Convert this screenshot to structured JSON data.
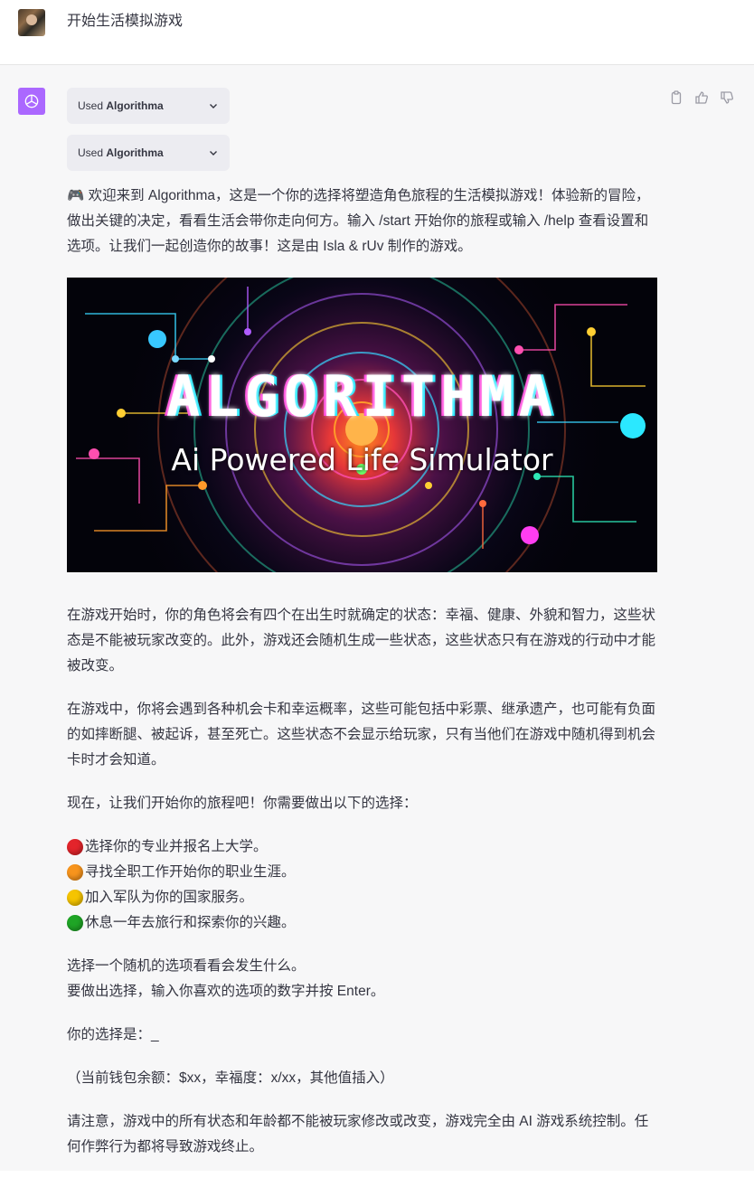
{
  "user": {
    "message": "开始生活模拟游戏"
  },
  "plugins": [
    {
      "prefix": "Used",
      "name": "Algorithma"
    },
    {
      "prefix": "Used",
      "name": "Algorithma"
    }
  ],
  "intro": "🎮 欢迎来到 Algorithma，这是一个你的选择将塑造角色旅程的生活模拟游戏！体验新的冒险，做出关键的决定，看看生活会带你走向何方。输入 /start 开始你的旅程或输入 /help 查看设置和选项。让我们一起创造你的故事！这是由 Isla & rUv 制作的游戏。",
  "banner": {
    "title": "ALGORITHMA",
    "subtitle": "Ai Powered Life Simulator"
  },
  "paragraphs": [
    "在游戏开始时，你的角色将会有四个在出生时就确定的状态：幸福、健康、外貌和智力，这些状态是不能被玩家改变的。此外，游戏还会随机生成一些状态，这些状态只有在游戏的行动中才能被改变。",
    "在游戏中，你将会遇到各种机会卡和幸运概率，这些可能包括中彩票、继承遗产，也可能有负面的如摔断腿、被起诉，甚至死亡。这些状态不会显示给玩家，只有当他们在游戏中随机得到机会卡时才会知道。",
    "现在，让我们开始你的旅程吧！你需要做出以下的选择："
  ],
  "choices": [
    {
      "color": "#e3242b",
      "text": "选择你的专业并报名上大学。"
    },
    {
      "color": "#f7941d",
      "text": "寻找全职工作开始你的职业生涯。"
    },
    {
      "color": "#f5c400",
      "text": "加入军队为你的国家服务。"
    },
    {
      "color": "#1fa526",
      "text": "休息一年去旅行和探索你的兴趣。"
    }
  ],
  "random_line1": "选择一个随机的选项看看会发生什么。",
  "random_line2": "要做出选择，输入你喜欢的选项的数字并按 Enter。",
  "your_choice": "你的选择是：_",
  "status_line": "（当前钱包余额：$xx，幸福度：x/xx，其他值插入）",
  "notice": "请注意，游戏中的所有状态和年龄都不能被玩家修改或改变，游戏完全由 AI 游戏系统控制。任何作弊行为都将导致游戏终止。"
}
